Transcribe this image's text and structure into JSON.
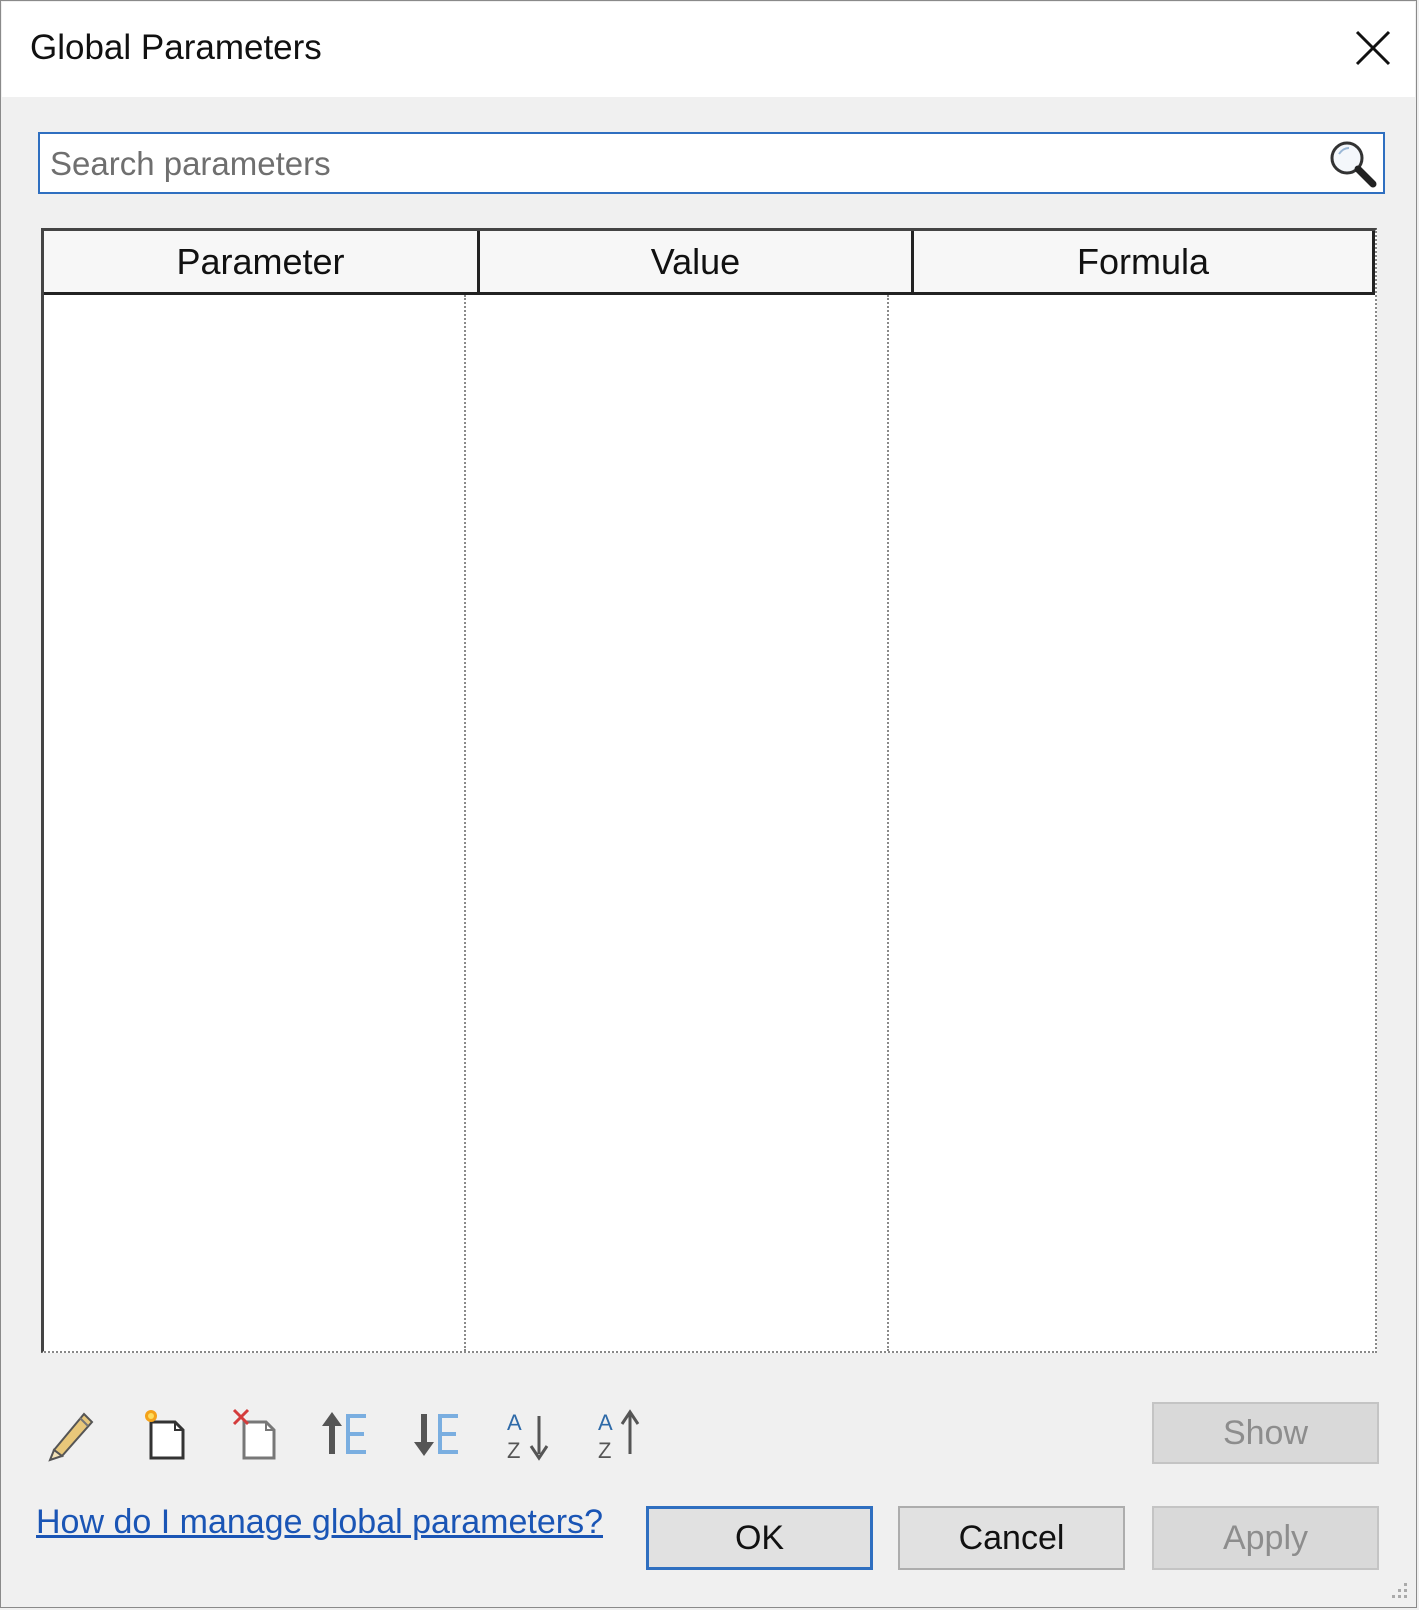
{
  "dialog": {
    "title": "Global Parameters"
  },
  "search": {
    "placeholder": "Search parameters",
    "value": ""
  },
  "table": {
    "columns": [
      "Parameter",
      "Value",
      "Formula"
    ],
    "rows": []
  },
  "toolbar": {
    "icons": [
      "edit-pencil-icon",
      "new-parameter-icon",
      "delete-parameter-icon",
      "move-up-icon",
      "move-down-icon",
      "sort-ascending-icon",
      "sort-descending-icon"
    ],
    "show_label": "Show"
  },
  "footer": {
    "help_link": "How do I manage global parameters?",
    "ok_label": "OK",
    "cancel_label": "Cancel",
    "apply_label": "Apply"
  },
  "colors": {
    "accent": "#2f6fc0",
    "link": "#1a55b5",
    "background": "#f0f0f0"
  }
}
